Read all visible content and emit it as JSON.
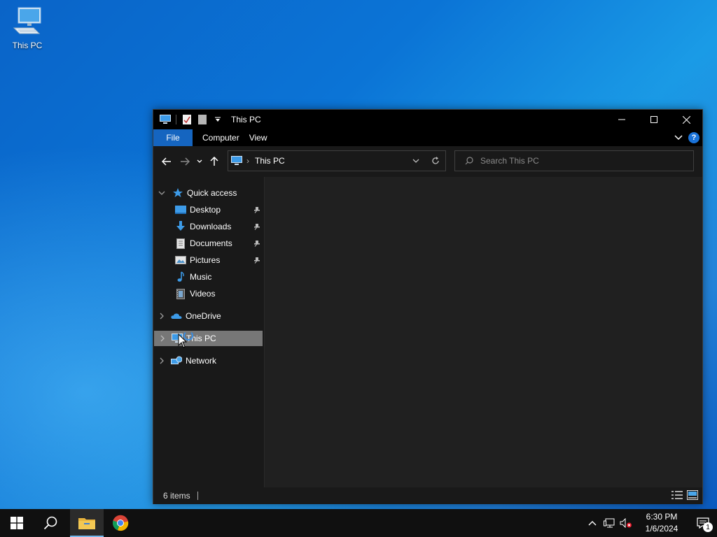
{
  "desktop": {
    "icons": [
      {
        "label": "This PC",
        "icon": "this-pc-icon"
      }
    ]
  },
  "window": {
    "title": "This PC",
    "ribbon_tabs": [
      "File",
      "Computer",
      "View"
    ],
    "help_label": "?",
    "address": {
      "crumb": "This PC"
    },
    "search": {
      "placeholder": "Search This PC"
    },
    "nav": {
      "quick_access": "Quick access",
      "items": [
        {
          "label": "Desktop",
          "pinned": true,
          "icon": "desktop-folder-icon"
        },
        {
          "label": "Downloads",
          "pinned": true,
          "icon": "downloads-folder-icon"
        },
        {
          "label": "Documents",
          "pinned": true,
          "icon": "documents-folder-icon"
        },
        {
          "label": "Pictures",
          "pinned": true,
          "icon": "pictures-folder-icon"
        },
        {
          "label": "Music",
          "pinned": false,
          "icon": "music-folder-icon"
        },
        {
          "label": "Videos",
          "pinned": false,
          "icon": "videos-folder-icon"
        }
      ],
      "onedrive": "OneDrive",
      "this_pc": "This PC",
      "network": "Network"
    },
    "status": {
      "items_count": "6 items"
    }
  },
  "taskbar": {
    "apps": [
      "start",
      "search",
      "file-explorer",
      "chrome"
    ],
    "clock": {
      "time": "6:30 PM",
      "date": "1/6/2024"
    },
    "notifications_count": "1"
  },
  "colors": {
    "accent": "#1565c0",
    "window_bg": "#191919",
    "content_bg": "#202020",
    "selected_row": "#777777",
    "taskbar_bg": "#101010"
  }
}
